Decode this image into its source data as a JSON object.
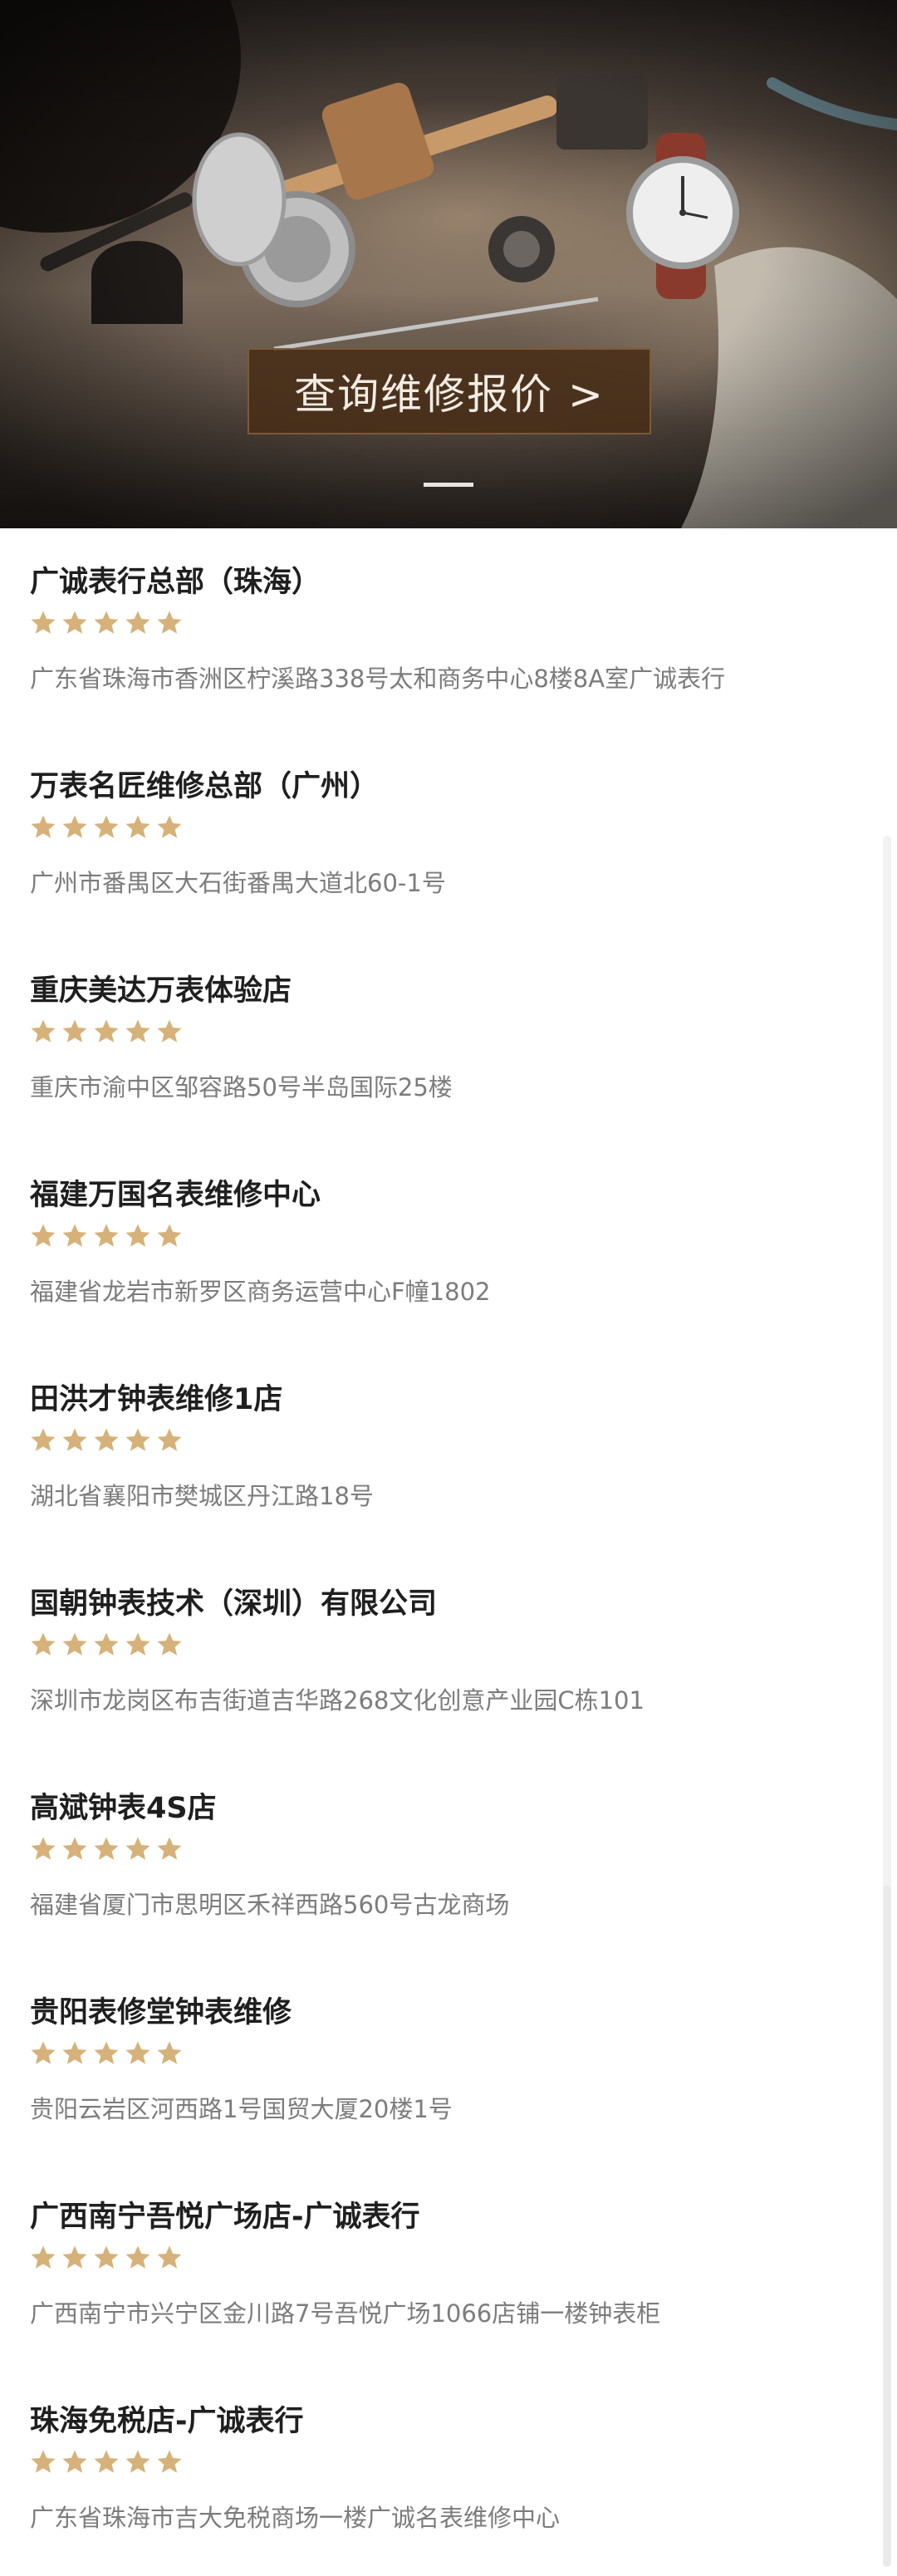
{
  "banner": {
    "cta_label": "查询维修报价 >"
  },
  "colors": {
    "star": "#d6b27a",
    "cta_bg": "#482d16",
    "name_text": "#1f1f1f",
    "address_text": "#7c7c7c"
  },
  "stores": [
    {
      "name": "广诚表行总部（珠海）",
      "rating": 5,
      "address": "广东省珠海市香洲区柠溪路338号太和商务中心8楼8A室广诚表行"
    },
    {
      "name": "万表名匠维修总部（广州）",
      "rating": 5,
      "address": "广州市番禺区大石街番禺大道北60-1号"
    },
    {
      "name": "重庆美达万表体验店",
      "rating": 5,
      "address": "重庆市渝中区邹容路50号半岛国际25楼"
    },
    {
      "name": "福建万国名表维修中心",
      "rating": 5,
      "address": "福建省龙岩市新罗区商务运营中心F幢1802"
    },
    {
      "name": "田洪才钟表维修1店",
      "rating": 5,
      "address": "湖北省襄阳市樊城区丹江路18号"
    },
    {
      "name": "国朝钟表技术（深圳）有限公司",
      "rating": 5,
      "address": "深圳市龙岗区布吉街道吉华路268文化创意产业园C栋101"
    },
    {
      "name": "高斌钟表4S店",
      "rating": 5,
      "address": "福建省厦门市思明区禾祥西路560号古龙商场"
    },
    {
      "name": "贵阳表修堂钟表维修",
      "rating": 5,
      "address": "贵阳云岩区河西路1号国贸大厦20楼1号"
    },
    {
      "name": "广西南宁吾悦广场店-广诚表行",
      "rating": 5,
      "address": "广西南宁市兴宁区金川路7号吾悦广场1066店铺一楼钟表柜"
    },
    {
      "name": "珠海免税店-广诚表行",
      "rating": 5,
      "address": "广东省珠海市吉大免税商场一楼广诚名表维修中心"
    }
  ]
}
